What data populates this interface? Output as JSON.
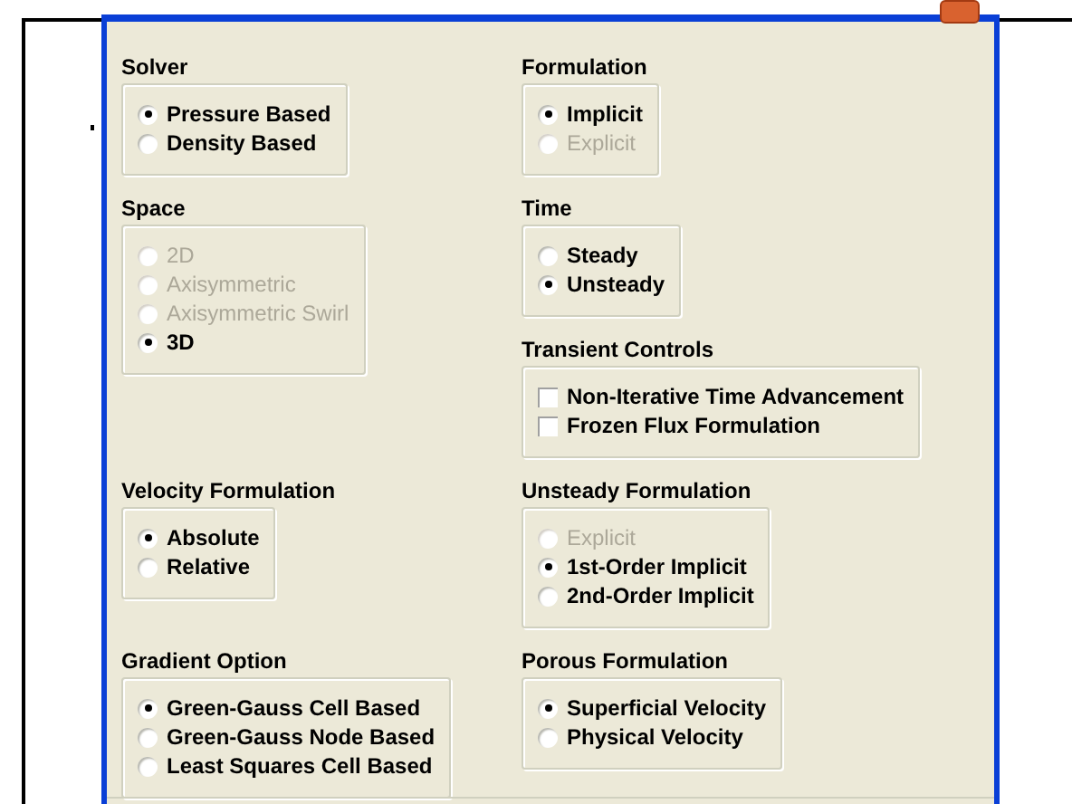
{
  "rows": [
    {
      "left": [
        {
          "title": "Solver",
          "kind": "radio",
          "options": [
            {
              "label": "Pressure Based",
              "selected": true,
              "disabled": false
            },
            {
              "label": "Density Based",
              "selected": false,
              "disabled": false
            }
          ]
        }
      ],
      "right": [
        {
          "title": "Formulation",
          "kind": "radio",
          "options": [
            {
              "label": "Implicit",
              "selected": true,
              "disabled": false
            },
            {
              "label": "Explicit",
              "selected": false,
              "disabled": true
            }
          ]
        }
      ]
    },
    {
      "left": [
        {
          "title": "Space",
          "kind": "radio",
          "options": [
            {
              "label": "2D",
              "selected": false,
              "disabled": true
            },
            {
              "label": "Axisymmetric",
              "selected": false,
              "disabled": true
            },
            {
              "label": "Axisymmetric Swirl",
              "selected": false,
              "disabled": true
            },
            {
              "label": "3D",
              "selected": true,
              "disabled": false
            }
          ]
        }
      ],
      "right": [
        {
          "title": "Time",
          "kind": "radio",
          "options": [
            {
              "label": "Steady",
              "selected": false,
              "disabled": false
            },
            {
              "label": "Unsteady",
              "selected": true,
              "disabled": false
            }
          ]
        },
        {
          "title": "Transient Controls",
          "kind": "checkbox",
          "options": [
            {
              "label": "Non-Iterative Time Advancement",
              "checked": false,
              "disabled": false
            },
            {
              "label": "Frozen Flux Formulation",
              "checked": false,
              "disabled": false
            }
          ]
        }
      ]
    },
    {
      "left": [
        {
          "title": "Velocity Formulation",
          "kind": "radio",
          "options": [
            {
              "label": "Absolute",
              "selected": true,
              "disabled": false
            },
            {
              "label": "Relative",
              "selected": false,
              "disabled": false
            }
          ]
        }
      ],
      "right": [
        {
          "title": "Unsteady Formulation",
          "kind": "radio",
          "options": [
            {
              "label": "Explicit",
              "selected": false,
              "disabled": true
            },
            {
              "label": "1st-Order Implicit",
              "selected": true,
              "disabled": false
            },
            {
              "label": "2nd-Order Implicit",
              "selected": false,
              "disabled": false
            }
          ]
        }
      ]
    },
    {
      "left": [
        {
          "title": "Gradient Option",
          "kind": "radio",
          "options": [
            {
              "label": "Green-Gauss Cell Based",
              "selected": true,
              "disabled": false
            },
            {
              "label": "Green-Gauss Node Based",
              "selected": false,
              "disabled": false
            },
            {
              "label": "Least Squares Cell Based",
              "selected": false,
              "disabled": false
            }
          ]
        }
      ],
      "right": [
        {
          "title": "Porous Formulation",
          "kind": "radio",
          "options": [
            {
              "label": "Superficial Velocity",
              "selected": true,
              "disabled": false
            },
            {
              "label": "Physical Velocity",
              "selected": false,
              "disabled": false
            }
          ]
        }
      ]
    }
  ]
}
